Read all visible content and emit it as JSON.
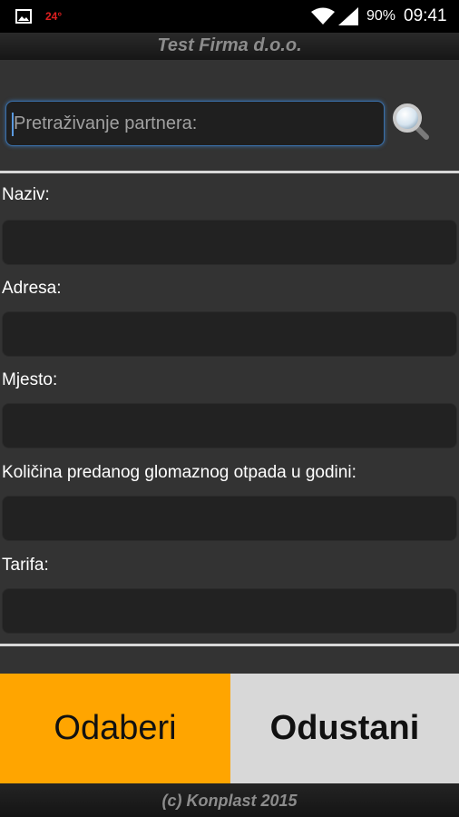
{
  "status_bar": {
    "temperature": "24°",
    "battery": "90%",
    "time": "09:41",
    "icons": [
      "image-icon",
      "wifi-icon",
      "signal-icon"
    ]
  },
  "app": {
    "title": "Test Firma d.o.o."
  },
  "search": {
    "placeholder": "Pretraživanje partnera:",
    "value": "",
    "icon": "search-icon"
  },
  "form": {
    "fields": [
      {
        "label": "Naziv:",
        "value": ""
      },
      {
        "label": "Adresa:",
        "value": ""
      },
      {
        "label": "Mjesto:",
        "value": ""
      },
      {
        "label": "Količina predanog glomaznog otpada u godini:",
        "value": ""
      },
      {
        "label": "Tarifa:",
        "value": ""
      }
    ]
  },
  "buttons": {
    "select_label": "Odaberi",
    "cancel_label": "Odustani"
  },
  "footer": {
    "text": "(c) Konplast 2015"
  },
  "colors": {
    "accent": "#ffa500",
    "secondary_button": "#d8d8d8",
    "background": "#333333",
    "focus_border": "#3a6fa8"
  }
}
